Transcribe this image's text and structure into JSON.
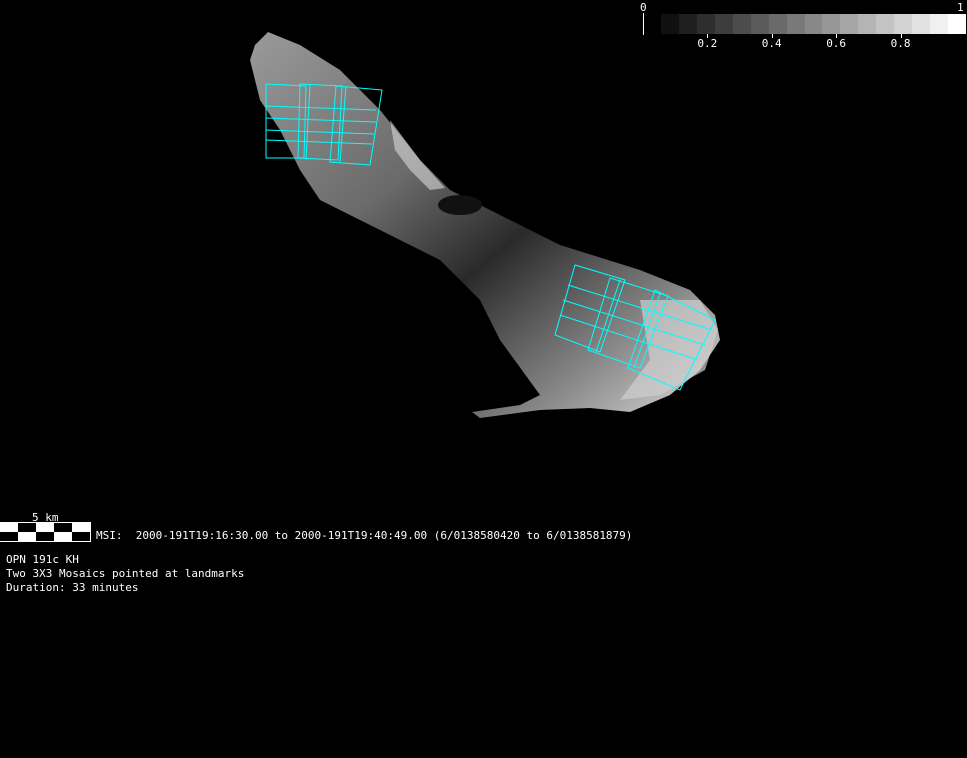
{
  "colorbar": {
    "min_label": "0",
    "max_label": "1",
    "tick_labels": [
      "0.2",
      "0.4",
      "0.6",
      "0.8"
    ],
    "tick_values": [
      0.2,
      0.4,
      0.6,
      0.8
    ],
    "swatch_count": 17
  },
  "scale_bar": {
    "label": "5 km"
  },
  "msi_line": "MSI:  2000-191T19:16:30.00 to 2000-191T19:40:49.00 (6/0138580420 to 6/0138581879)",
  "info": {
    "opn": "OPN 191c KH",
    "description": "Two 3X3 Mosaics pointed at landmarks",
    "duration": "Duration: 33 minutes"
  },
  "colors": {
    "background": "#000000",
    "footprint": "#00ffff"
  }
}
